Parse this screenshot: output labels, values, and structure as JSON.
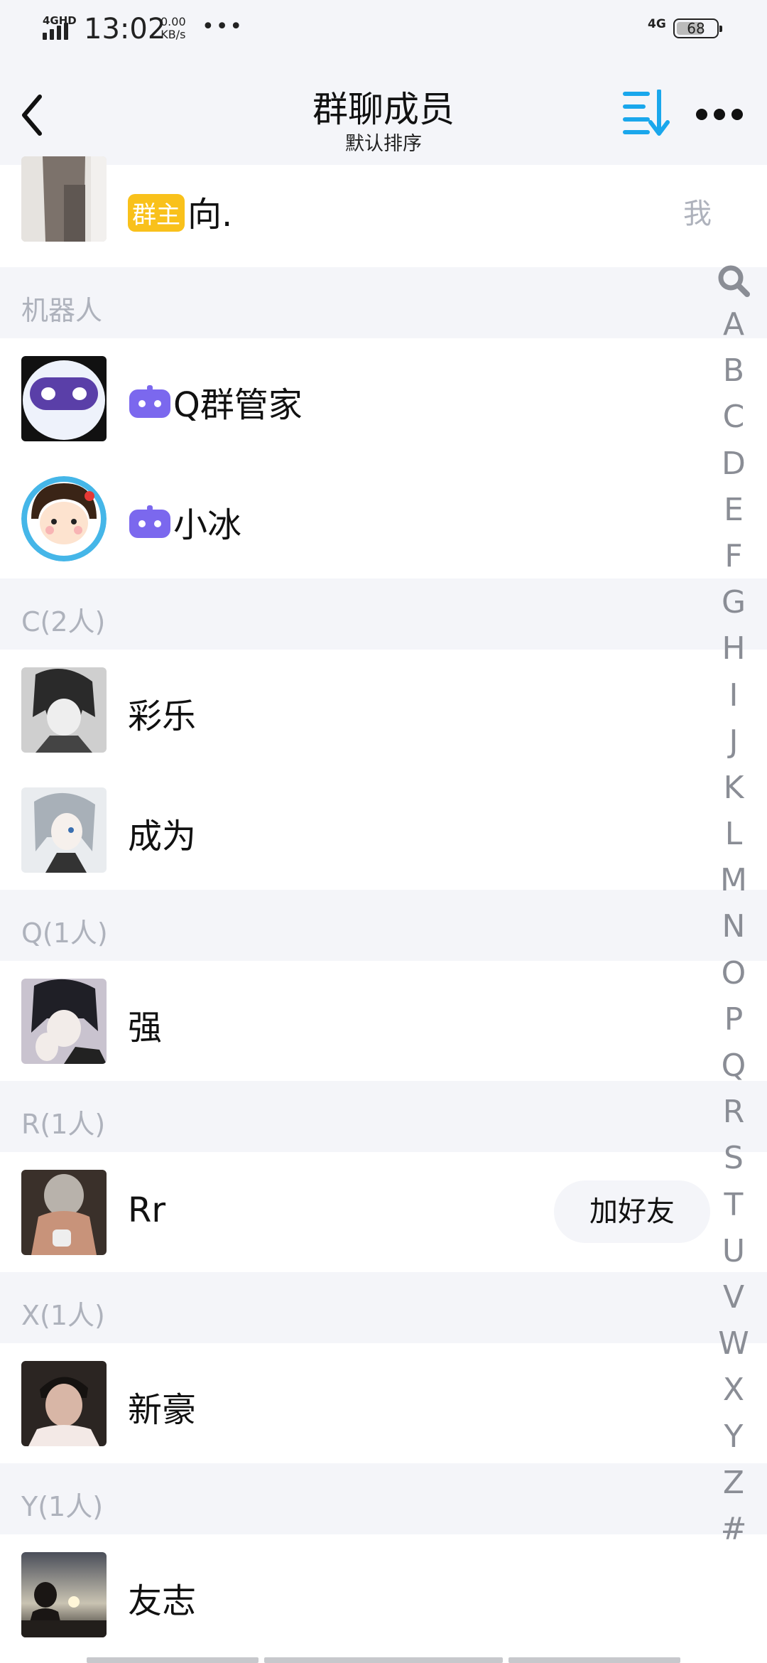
{
  "status_bar": {
    "network": "4GHD",
    "time": "13:02",
    "speed_value": "0.00",
    "speed_unit": "KB/s",
    "more": "•••",
    "network_right": "4G",
    "battery": "68"
  },
  "header": {
    "title": "群聊成员",
    "subtitle": "默认排序",
    "icons": {
      "back": "back-chevron-icon",
      "sort": "sort-icon",
      "more": "more-dots-icon"
    },
    "accent_color": "#1aa7ec"
  },
  "owner": {
    "badge": "群主",
    "name": "向.",
    "me_label": "我"
  },
  "sections": [
    {
      "title": "机器人",
      "members": [
        {
          "name": "Q群管家",
          "bot": true
        },
        {
          "name": "小冰",
          "bot": true
        }
      ]
    },
    {
      "title": "C(2人)",
      "members": [
        {
          "name": "彩乐"
        },
        {
          "name": "成为"
        }
      ]
    },
    {
      "title": "Q(1人)",
      "members": [
        {
          "name": "强"
        }
      ]
    },
    {
      "title": "R(1人)",
      "members": [
        {
          "name": "Rr",
          "add_friend": "加好友"
        }
      ]
    },
    {
      "title": "X(1人)",
      "members": [
        {
          "name": "新豪"
        }
      ]
    },
    {
      "title": "Y(1人)",
      "members": [
        {
          "name": "友志"
        }
      ]
    }
  ],
  "index_letters": [
    "A",
    "B",
    "C",
    "D",
    "E",
    "F",
    "G",
    "H",
    "I",
    "J",
    "K",
    "L",
    "M",
    "N",
    "O",
    "P",
    "Q",
    "R",
    "S",
    "T",
    "U",
    "V",
    "W",
    "X",
    "Y",
    "Z",
    "#"
  ],
  "colors": {
    "owner_badge": "#f9c11b",
    "bot_icon": "#7b68ee",
    "section_bg": "#f4f5f9",
    "section_text": "#aeb2bc"
  }
}
